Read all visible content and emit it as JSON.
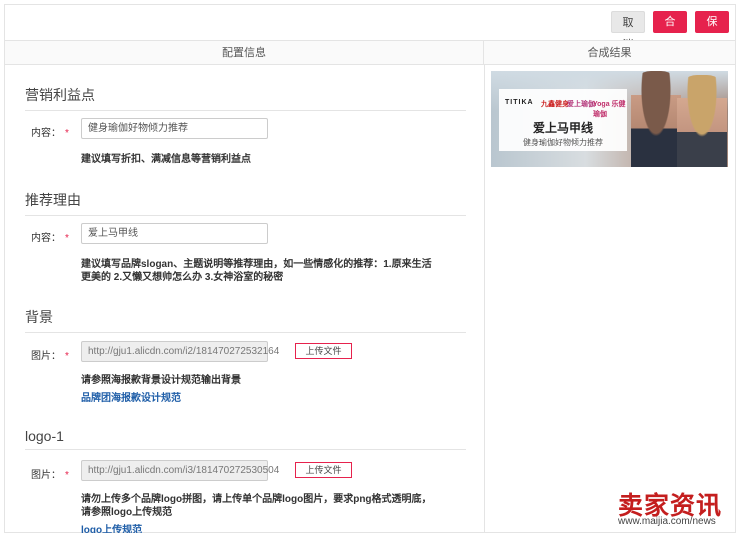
{
  "toolbar": {
    "cancel_label": "取消",
    "compose_label": "合成",
    "save_label": "保存"
  },
  "columns": {
    "left_title": "配置信息",
    "right_title": "合成结果"
  },
  "sections": {
    "marketing": {
      "title": "营销利益点",
      "field_label": "内容：",
      "required_mark": "*",
      "value": "健身瑜伽好物倾力推荐",
      "hint": "建议填写折扣、满减信息等营销利益点"
    },
    "reason": {
      "title": "推荐理由",
      "field_label": "内容：",
      "required_mark": "*",
      "value": "爱上马甲线",
      "hint_line1": "建议填写品牌slogan、主题说明等推荐理由，如一些情感化的推荐：1.原来生活",
      "hint_line2": "更美的 2.又懒又想帅怎么办 3.女神浴室的秘密"
    },
    "background": {
      "title": "背景",
      "field_label": "图片：",
      "required_mark": "*",
      "value": "http://gju1.alicdn.com/i2/181470272532164",
      "upload_label": "上传文件",
      "hint": "请参照海报款背景设计规范输出背景",
      "link": "品牌团海报款设计规范"
    },
    "logo1": {
      "title": "logo-1",
      "field_label": "图片：",
      "required_mark": "*",
      "value": "http://gju1.alicdn.com/i3/181470272530504",
      "upload_label": "上传文件",
      "hint_line1": "请勿上传多个品牌logo拼图，请上传单个品牌logo图片，要求png格式透明底，",
      "hint_line2": "请参照logo上传规范",
      "link": "logo上传规范"
    }
  },
  "preview": {
    "brand1": "TITIKA",
    "brand2": "九鑫健身",
    "brand3": "爱上瑜伽",
    "brand4": "Yoga 乐健瑜伽",
    "title": "爱上马甲线",
    "subtitle": "健身瑜伽好物倾力推荐"
  },
  "watermark": {
    "title": "卖家资讯",
    "url": "www.maijia.com/news"
  },
  "colors": {
    "accent": "#e6224d",
    "link": "#1f5ea8"
  }
}
